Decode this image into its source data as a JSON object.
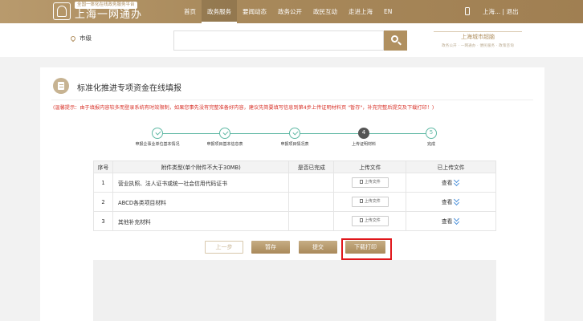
{
  "header": {
    "logo_tag": "全国一体化在线政务服务平台",
    "logo_title": "上海一网通办",
    "nav": [
      "首页",
      "政务服务",
      "要闻动态",
      "政务公开",
      "政民互动",
      "走进上海",
      "EN"
    ],
    "active_nav_index": 1,
    "user_text": "上海...",
    "separator": "|",
    "logout": "退出"
  },
  "search": {
    "city": "市级",
    "placeholder": "",
    "brand_title": "上海城市超脑",
    "brand_sub": "政务公开 · 一网通办 · 便民服务 · 政策咨询"
  },
  "page": {
    "title": "标准化推进专项资金在线填报",
    "tip": "(温馨提示：由于填报内容较多而登录系统有时效限制，如果您事先没有完整准备好内容，建议先简要填写信息到第4步上传证明材料页 \"暂存\"，补充完整后提交及下载打印！)"
  },
  "steps": [
    {
      "num": "1",
      "label": "申报企事业单位基本情况",
      "state": "done"
    },
    {
      "num": "2",
      "label": "申报项目基本信息表",
      "state": "done"
    },
    {
      "num": "3",
      "label": "申报项目情况表",
      "state": "done"
    },
    {
      "num": "4",
      "label": "上传证明材料",
      "state": "current"
    },
    {
      "num": "5",
      "label": "完成",
      "state": "todo"
    }
  ],
  "table": {
    "headers": [
      "序号",
      "附件类型(单个附件不大于30MB)",
      "是否已完成",
      "上传文件",
      "已上传文件"
    ],
    "rows": [
      {
        "no": "1",
        "type": "营业执照、法人证书或统一社会信用代码证书",
        "done": "",
        "upload": "上传文件",
        "view": "查看"
      },
      {
        "no": "2",
        "type": "ABCD各类项目材料",
        "done": "",
        "upload": "上传文件",
        "view": "查看"
      },
      {
        "no": "3",
        "type": "其他补充材料",
        "done": "",
        "upload": "上传文件",
        "view": "查看"
      }
    ]
  },
  "actions": {
    "prev": "上一步",
    "save": "暂存",
    "submit": "提交",
    "print": "下载打印"
  }
}
